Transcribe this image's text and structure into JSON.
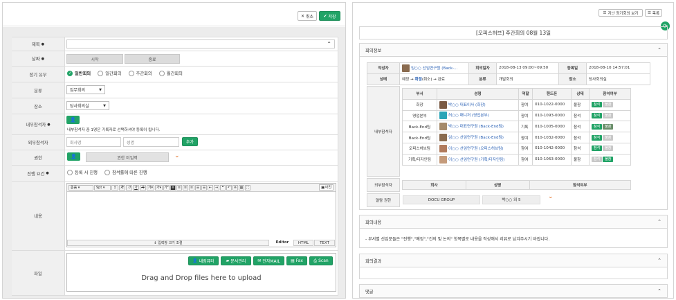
{
  "left": {
    "toolbar": {
      "cancel_label": "취소",
      "save_label": "저장"
    },
    "fields": {
      "title_label": "제목",
      "date_label": "날짜",
      "date_start": "시작",
      "date_end": "종료",
      "regular_label": "정기 유무",
      "regular_options": [
        "일반회의",
        "일간회의",
        "주간회의",
        "월간회의"
      ],
      "category_label": "분류",
      "category_value": "업무회의",
      "place_label": "장소",
      "place_value": "당사회의실",
      "internal_label": "내부참석자",
      "internal_note": "내부참석자 중 1명은 기록자로 선택하셔야 등록이 됩니다.",
      "external_label": "외부참석자",
      "external_company_placeholder": "회사명",
      "external_name_placeholder": "성명",
      "external_add": "추가",
      "auth_label": "권한",
      "auth_value": "권한 미입력",
      "progress_label": "진행 요건",
      "progress_options": [
        "등록 시 진행",
        "참석률에 따른 진행"
      ],
      "content_label": "내용",
      "file_label": "파일"
    },
    "editor": {
      "font_select": "돋움",
      "size_select": "9pt",
      "source_label": "사진",
      "resize_label": "입력창 크기 조절",
      "tabs": [
        "Editor",
        "HTML",
        "TEXT"
      ]
    },
    "upload": {
      "buttons": [
        "내컴퓨터",
        "문서관리",
        "전자MAIL",
        "Fax",
        "Scan"
      ],
      "drop_text": "Drag and Drop files here to upload"
    }
  },
  "right": {
    "toolbar": {
      "prev_label": "지난 정기회의 보기",
      "list_label": "목록"
    },
    "title": "[오피스허브] 주간회의 08월 13일",
    "section_info": "회의정보",
    "info": {
      "writer_label": "작성자",
      "writer_value": "임○○ 선임연구원 (Back-...",
      "date_label": "회의일자",
      "date_value": "2018-08-13 09:00~09:50",
      "reg_label": "등록일",
      "reg_value": "2018-08-10 14:57:01",
      "status_label": "상태",
      "status_flow": [
        "예정",
        "확정",
        "(취소)",
        "완료"
      ],
      "category_label": "분류",
      "category_value": "개발회의",
      "place_label": "장소",
      "place_value": "당사회의실",
      "internal_label": "내부참석자",
      "external_label": "외부참석자",
      "auth_label": "열람 권한"
    },
    "attendees_headers": [
      "부서",
      "성명",
      "역할",
      "핸드폰",
      "상태",
      "참석여부"
    ],
    "attendees": [
      {
        "dept": "회장",
        "name": "박○○ 대표이사 (회장)",
        "role": "참여",
        "phone": "010-1022-0000",
        "state": "불참",
        "yes": "참석",
        "no": "불참",
        "active": "no"
      },
      {
        "dept": "영업본부",
        "name": "허○○ 매니저 (영업본부)",
        "role": "참여",
        "phone": "010-1093-0000",
        "state": "참석",
        "yes": "참석",
        "no": "불참",
        "active": "yes"
      },
      {
        "dept": "Back-End팀",
        "name": "박○○ 대표연구원 (Back-End팀)",
        "role": "기록",
        "phone": "010-1005-0000",
        "state": "참석",
        "yes": "참석",
        "no": "불참",
        "active": "both"
      },
      {
        "dept": "Back-End팀",
        "name": "임○○ 선임연구원 (Back-End팀)",
        "role": "참여",
        "phone": "010-1032-0000",
        "state": "참석",
        "yes": "참석",
        "no": "불참",
        "active": "yes"
      },
      {
        "dept": "오피스허브팀",
        "name": "이○○ 선임연구원 (오피스허브팀)",
        "role": "참여",
        "phone": "010-1042-0000",
        "state": "참석",
        "yes": "참석",
        "no": "불참",
        "active": "yes"
      },
      {
        "dept": "기획/디자인팀",
        "name": "이○○ 선임연구원 (기획/디자인팀)",
        "role": "참여",
        "phone": "010-1063-0000",
        "state": "불참",
        "yes": "참석",
        "no": "불참",
        "active": "no"
      }
    ],
    "external_headers": [
      "회사",
      "성명",
      "참석여부"
    ],
    "auth_values": [
      "DOCU GROUP",
      "박○○ 외 5"
    ],
    "section_content": "회의내용",
    "content_text": "- 부서별 선임분들은 \"진행\",\"예정\",\"건의 및 논의\" 항목별로 내용을 작성해서 리뷰로 남겨주시기 바랍니다.",
    "section_result": "회의결과",
    "section_comment": "댓글"
  },
  "colors": {
    "accent": "#21a366",
    "link": "#2a61b5",
    "warn": "#e26a1b"
  }
}
